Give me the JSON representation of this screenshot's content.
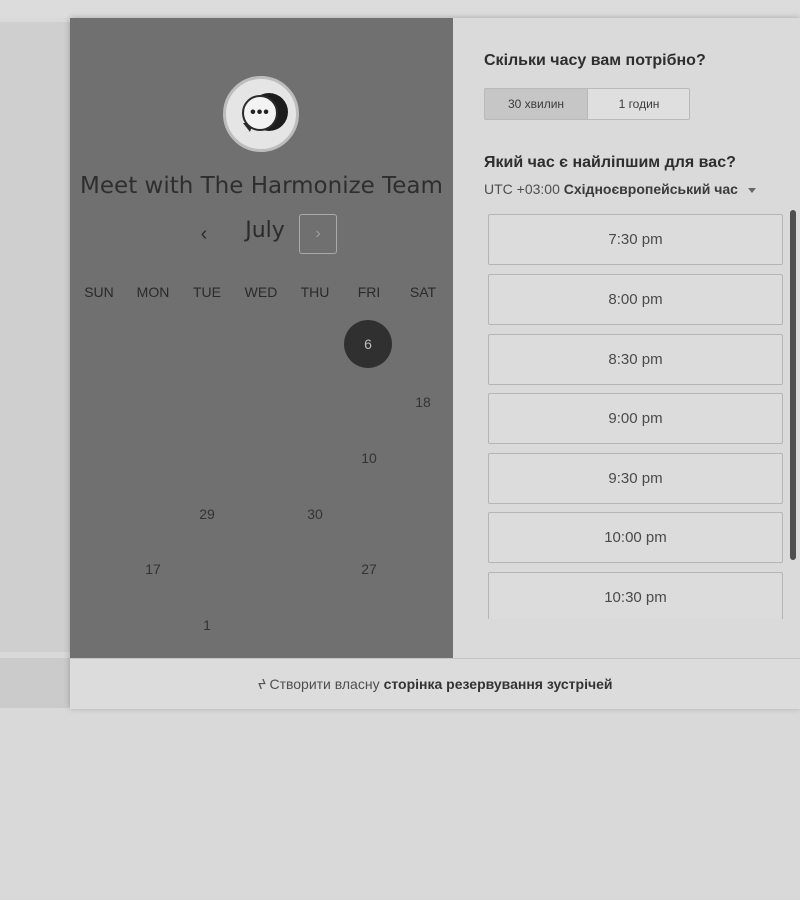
{
  "booking": {
    "title": "Meet with The Harmonize Team",
    "month": "July",
    "prev_glyph": "‹",
    "next_glyph": "›",
    "weekdays": [
      "SUN",
      "MON",
      "TUE",
      "WED",
      "THU",
      "FRI",
      "SAT"
    ],
    "days": {
      "fri_6": "6",
      "sat_18": "18",
      "fri_10": "10",
      "tue_29": "29",
      "thu_30": "30",
      "mon_17": "17",
      "fri_27": "27",
      "tue_1": "1"
    },
    "selected_day": "6",
    "logo": {
      "icon": "chat-bubble-logo",
      "dots": "•••"
    }
  },
  "duration": {
    "question": "Скільки часу вам потрібно?",
    "options": [
      "30 хвилин",
      "1 годин"
    ],
    "selected": "30 хвилин"
  },
  "time": {
    "question": "Який час є найліпшим для вас?",
    "timezone_offset": "UTC +03:00",
    "timezone_name": "Східноєвропейський час",
    "slots": [
      "7:30 pm",
      "8:00 pm",
      "8:30 pm",
      "9:00 pm",
      "9:30 pm",
      "10:00 pm",
      "10:30 pm"
    ]
  },
  "footer": {
    "icon": "hubspot-sprocket-icon",
    "prefix": "Створити власну",
    "link": "сторінка резервування зустрічей"
  },
  "colors": {
    "left_panel": "#707070",
    "right_panel": "#dadada",
    "selected_day": "#303030"
  }
}
